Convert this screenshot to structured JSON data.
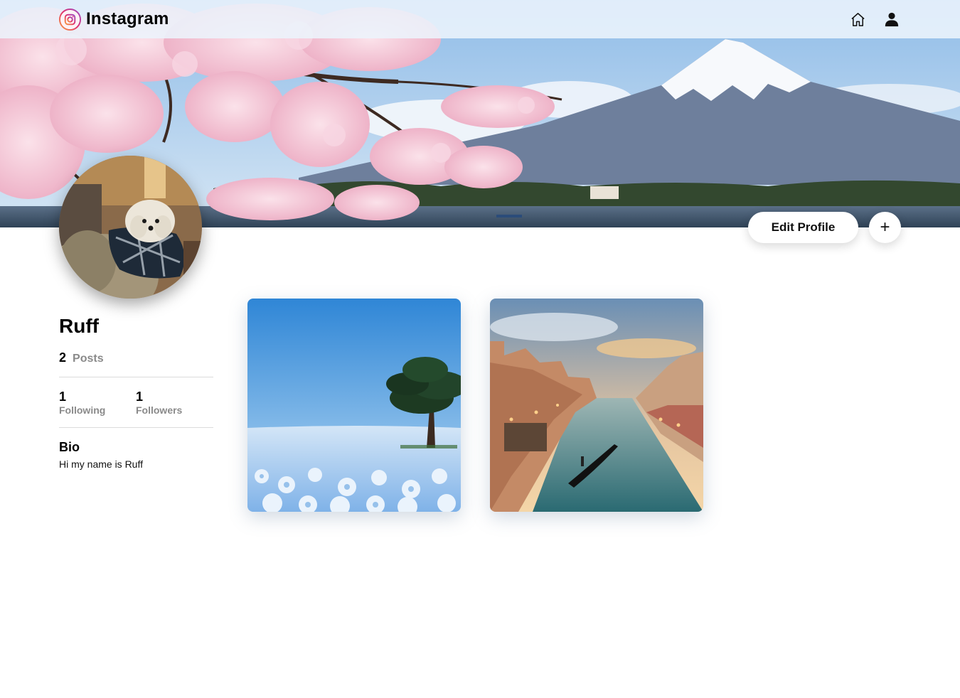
{
  "app": {
    "name": "Instagram"
  },
  "nav": {
    "icons": [
      "home-icon",
      "user-icon"
    ]
  },
  "cover": {
    "scene": "cherry-blossom-mountain-lake"
  },
  "profile": {
    "name": "Ruff",
    "posts_count": "2",
    "posts_label": "Posts",
    "following_count": "1",
    "following_label": "Following",
    "followers_count": "1",
    "followers_label": "Followers",
    "bio_title": "Bio",
    "bio_text": "Hi my name is Ruff"
  },
  "actions": {
    "edit_label": "Edit Profile",
    "add_label": "+"
  },
  "posts": [
    {
      "scene": "blue-flower-field-with-tree"
    },
    {
      "scene": "canal-with-gondola-at-sunset"
    }
  ],
  "colors": {
    "topbar": "#ecf4fc",
    "muted_text": "#8a8a8a",
    "blossom": "#f3c2d3",
    "sky": "#9cc3ea"
  }
}
